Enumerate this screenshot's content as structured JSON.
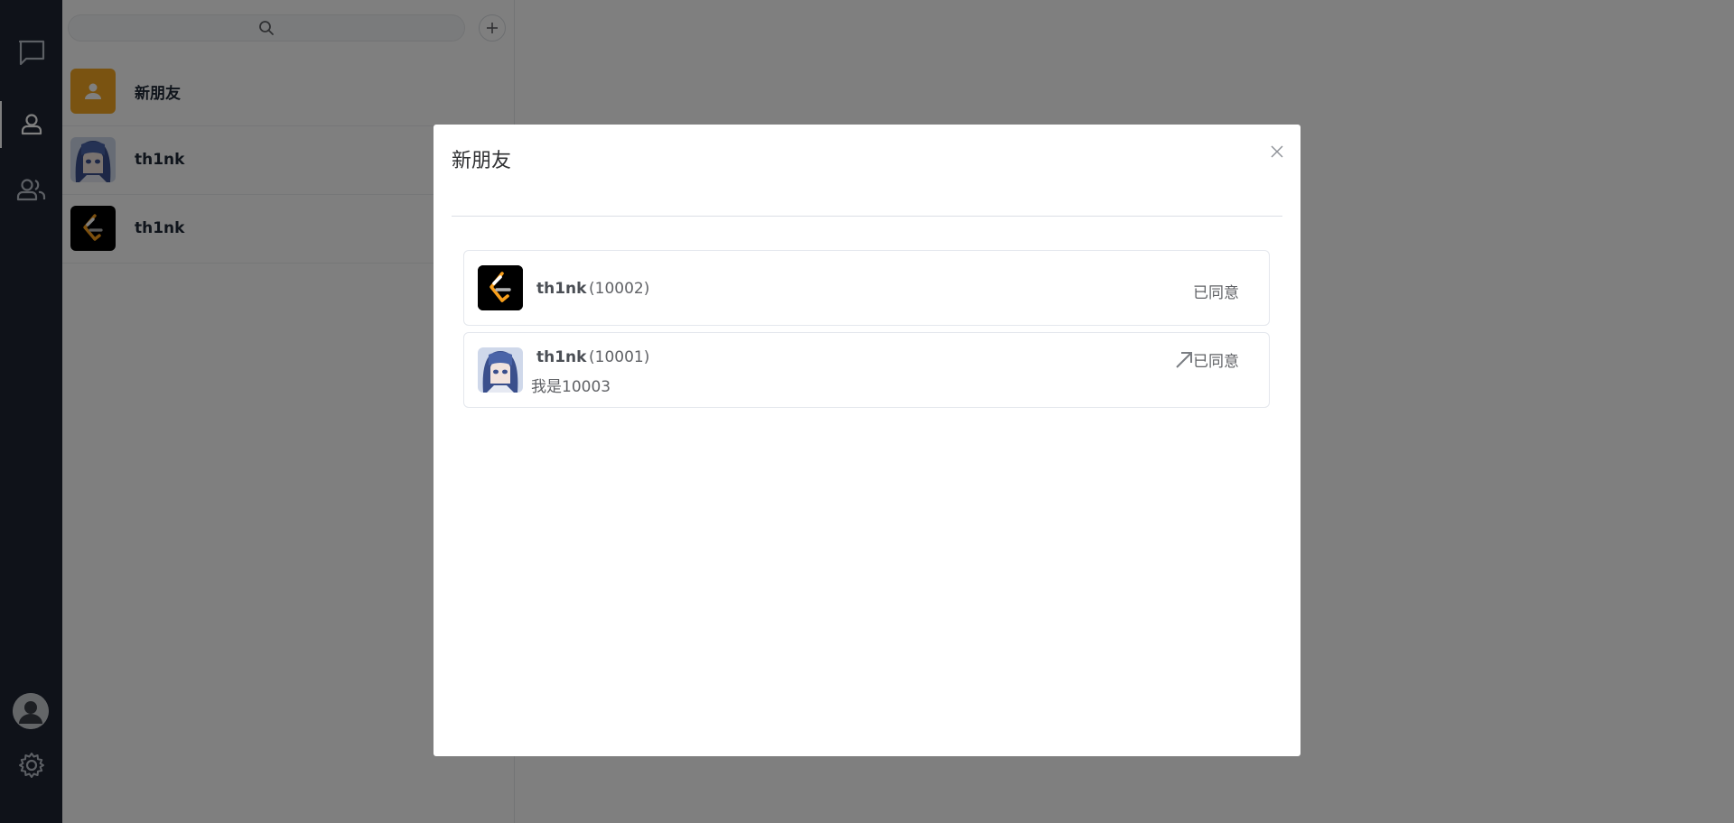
{
  "rail": {
    "items": [
      {
        "icon": "chat-icon"
      },
      {
        "icon": "contacts-icon",
        "active": true
      },
      {
        "icon": "group-icon"
      }
    ],
    "bottom": [
      {
        "icon": "user-avatar"
      },
      {
        "icon": "gear-icon"
      }
    ]
  },
  "panel": {
    "search_icon": "search-icon",
    "add_icon": "plus-icon",
    "contacts": [
      {
        "name": "新朋友",
        "avatar": "new-friend-avatar"
      },
      {
        "name": "th1nk",
        "avatar": "anime-avatar"
      },
      {
        "name": "th1nk",
        "avatar": "leetcode-logo-avatar"
      }
    ]
  },
  "modal": {
    "title": "新朋友",
    "close_icon": "close-icon",
    "requests": [
      {
        "name": "th1nk",
        "id": "(10002)",
        "message": "",
        "status": "已同意",
        "avatar": "leetcode-logo-avatar",
        "direction_icon": ""
      },
      {
        "name": "th1nk",
        "id": "(10001)",
        "message": "我是10003",
        "status": "已同意",
        "avatar": "anime-avatar",
        "direction_icon": "arrow-up-right-icon"
      }
    ]
  },
  "colors": {
    "rail_bg": "#1e2533",
    "new_friend_avatar": "#f5a623",
    "overlay": "rgba(0,0,0,0.5)"
  }
}
